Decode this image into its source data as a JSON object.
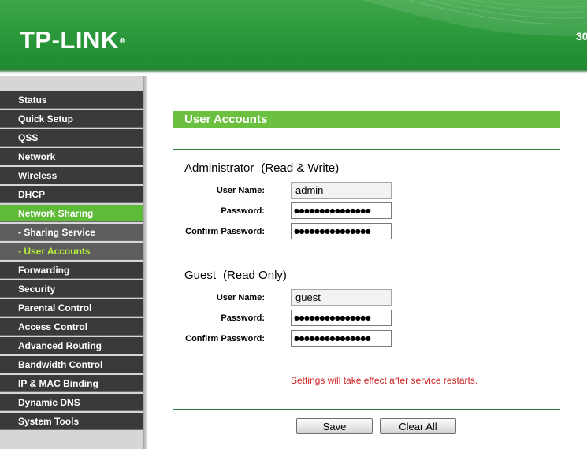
{
  "brand": {
    "logo": "TP-LINK",
    "logo_mark": "®",
    "model": "30"
  },
  "colors": {
    "header_green": "#2c9a3c",
    "nav_bg": "#3a3a3a",
    "nav_active": "#5ebb38",
    "nav_sub": "#5d5d5d",
    "nav_sub_current_text": "#b6ef3a",
    "section_title_bg": "#6cc040",
    "notice_red": "#cc2222"
  },
  "sidebar": {
    "items": [
      {
        "label": "Status",
        "state": "normal"
      },
      {
        "label": "Quick Setup",
        "state": "normal"
      },
      {
        "label": "QSS",
        "state": "normal"
      },
      {
        "label": "Network",
        "state": "normal"
      },
      {
        "label": "Wireless",
        "state": "normal"
      },
      {
        "label": "DHCP",
        "state": "normal"
      },
      {
        "label": "Network Sharing",
        "state": "active"
      },
      {
        "label": "- Sharing Service",
        "state": "sub"
      },
      {
        "label": "- User Accounts",
        "state": "sub-current"
      },
      {
        "label": "Forwarding",
        "state": "normal"
      },
      {
        "label": "Security",
        "state": "normal"
      },
      {
        "label": "Parental Control",
        "state": "normal"
      },
      {
        "label": "Access Control",
        "state": "normal"
      },
      {
        "label": "Advanced Routing",
        "state": "normal"
      },
      {
        "label": "Bandwidth Control",
        "state": "normal"
      },
      {
        "label": "IP & MAC Binding",
        "state": "normal"
      },
      {
        "label": "Dynamic DNS",
        "state": "normal"
      },
      {
        "label": "System Tools",
        "state": "normal"
      }
    ]
  },
  "main": {
    "section_title": "User Accounts",
    "administrator": {
      "title": "Administrator",
      "role": "(Read & Write)",
      "username_label": "User Name:",
      "username_value": "admin",
      "password_label": "Password:",
      "password_value": "●●●●●●●●●●●●●●●",
      "confirm_label": "Confirm Password:",
      "confirm_value": "●●●●●●●●●●●●●●●"
    },
    "guest": {
      "title": "Guest",
      "role": "(Read Only)",
      "username_label": "User Name:",
      "username_value": "guest",
      "password_label": "Password:",
      "password_value": "●●●●●●●●●●●●●●●",
      "confirm_label": "Confirm Password:",
      "confirm_value": "●●●●●●●●●●●●●●●"
    },
    "notice": "Settings will take effect after service restarts.",
    "buttons": {
      "save": "Save",
      "clear_all": "Clear All"
    }
  }
}
